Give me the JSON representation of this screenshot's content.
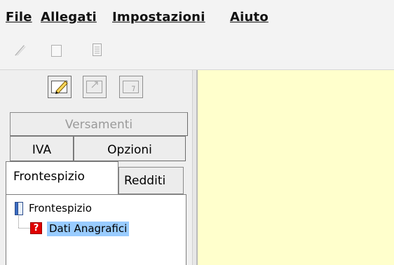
{
  "menubar": {
    "items": [
      {
        "label": "File"
      },
      {
        "label": "Allegati"
      },
      {
        "label": "Impostazioni"
      },
      {
        "label": "Aiuto"
      }
    ]
  },
  "toolbar": {
    "icons": [
      "pen-icon",
      "blank-page-icon",
      "document-icon"
    ]
  },
  "side_toolbar": {
    "icons": [
      "edit-form-icon",
      "form-corner-icon",
      "form-numbered-icon"
    ]
  },
  "section_tabs": {
    "versamenti": "Versamenti",
    "iva": "IVA",
    "opzioni": "Opzioni"
  },
  "form_tabs": {
    "frontespizio": "Frontespizio",
    "redditi": "Redditi"
  },
  "tree": {
    "root": "Frontespizio",
    "child": "Dati Anagrafici",
    "child_badge": "?"
  },
  "colors": {
    "content_bg": "#ffffcc",
    "selection": "#99ccff",
    "badge_red": "#e00000"
  }
}
